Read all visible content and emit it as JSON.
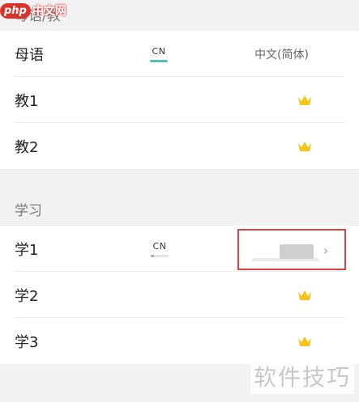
{
  "watermarks": {
    "top_logo": "php",
    "top_site": "中文网",
    "bottom": "软件技巧"
  },
  "sections": {
    "native_teach": {
      "header": "母语/教",
      "rows": [
        {
          "label": "母语",
          "lang_code": "CN",
          "value": "中文(简体)"
        },
        {
          "label": "教1",
          "icon": "crown-icon"
        },
        {
          "label": "教2",
          "icon": "crown-icon"
        }
      ]
    },
    "learn": {
      "header": "学习",
      "rows": [
        {
          "label": "学1",
          "lang_code": "CN",
          "progress": 0.2,
          "chevron": "›"
        },
        {
          "label": "学2",
          "icon": "crown-icon"
        },
        {
          "label": "学3",
          "icon": "crown-icon"
        }
      ]
    }
  },
  "colors": {
    "accent": "#4fc0b8",
    "crown": "#f5c518",
    "highlight_border": "#d94545"
  }
}
